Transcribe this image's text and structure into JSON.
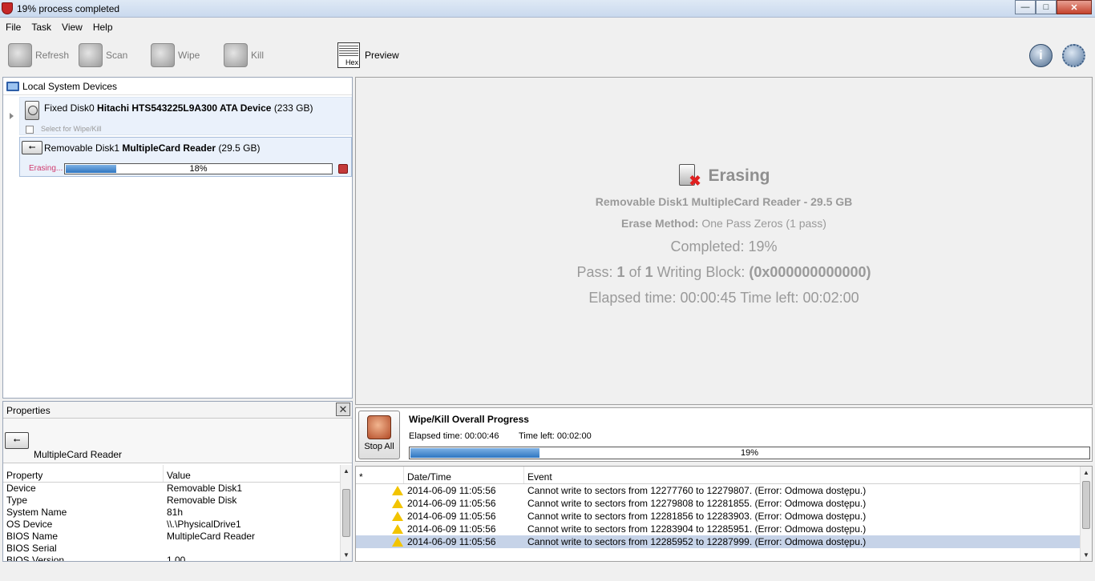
{
  "window": {
    "title": "19% process completed",
    "buttons": {
      "minimize": "—",
      "maximize": "□",
      "close": "✕"
    }
  },
  "menu": [
    "File",
    "Task",
    "View",
    "Help"
  ],
  "toolbar": {
    "refresh": "Refresh",
    "scan": "Scan",
    "wipe": "Wipe",
    "kill": "Kill",
    "preview": "Preview",
    "hex_label": "Hex",
    "info_glyph": "i"
  },
  "devices": {
    "header": "Local System Devices",
    "disk0": {
      "prefix": "Fixed Disk0",
      "name": "Hitachi HTS543225L9A300 ATA Device",
      "size": "(233 GB)",
      "select_label": "Select for Wipe/Kill"
    },
    "disk1": {
      "prefix": "Removable Disk1",
      "name": "MultipleCard Reader",
      "size": "(29.5 GB)",
      "status": "Erasing...",
      "progress_text": "18%",
      "progress": 0.19
    }
  },
  "properties": {
    "title": "Properties",
    "close_glyph": "✕",
    "device_name": "MultipleCard  Reader",
    "columns": [
      "Property",
      "Value"
    ],
    "rows": [
      [
        "Device",
        "Removable Disk1"
      ],
      [
        "Type",
        "Removable Disk"
      ],
      [
        "System Name",
        "81h"
      ],
      [
        "OS Device",
        "\\\\.\\PhysicalDrive1"
      ],
      [
        "BIOS Name",
        "MultipleCard  Reader"
      ],
      [
        "BIOS Serial",
        ""
      ],
      [
        "BIOS Version",
        "1.00"
      ]
    ]
  },
  "status": {
    "heading": "Erasing",
    "device_line": "Removable Disk1 MultipleCard Reader - 29.5 GB",
    "method_label": "Erase Method:",
    "method_value": "One Pass Zeros (1 pass)",
    "completed": "Completed: 19%",
    "pass_label": "Pass:",
    "pass_current": "1",
    "pass_of": "of",
    "pass_total": "1",
    "writing_label": "Writing Block:",
    "writing_value": "(0x000000000000)",
    "elapsed_time": "Elapsed time: 00:00:45 Time left: 00:02:00"
  },
  "overall": {
    "stop_all": "Stop All",
    "title": "Wipe/Kill Overall Progress",
    "elapsed": "Elapsed time: 00:00:46",
    "time_left": "Time left: 00:02:00",
    "progress_text": "19%",
    "progress": 0.19
  },
  "events": {
    "columns": [
      "*",
      "Date/Time",
      "Event"
    ],
    "rows": [
      {
        "datetime": "2014-06-09 11:05:56",
        "event": "Cannot write to sectors from 12277760 to 12279807. (Error: Odmowa dostępu.)"
      },
      {
        "datetime": "2014-06-09 11:05:56",
        "event": "Cannot write to sectors from 12279808 to 12281855. (Error: Odmowa dostępu.)"
      },
      {
        "datetime": "2014-06-09 11:05:56",
        "event": "Cannot write to sectors from 12281856 to 12283903. (Error: Odmowa dostępu.)"
      },
      {
        "datetime": "2014-06-09 11:05:56",
        "event": "Cannot write to sectors from 12283904 to 12285951. (Error: Odmowa dostępu.)"
      },
      {
        "datetime": "2014-06-09 11:05:56",
        "event": "Cannot write to sectors from 12285952 to 12287999. (Error: Odmowa dostępu.)"
      }
    ],
    "selected_index": 4
  },
  "colors": {
    "progress_fill": "#2d75c0",
    "erasing_text": "#d03a6e",
    "warning": "#f2c400",
    "selected_row": "#c6d3e8"
  }
}
